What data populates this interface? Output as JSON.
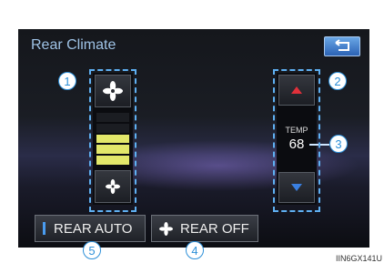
{
  "screen": {
    "title": "Rear Climate"
  },
  "fan": {
    "level_count": 5,
    "active_levels": 3,
    "active_color": "#e3e86a",
    "inactive_color": "#1b1d22"
  },
  "temperature": {
    "label": "TEMP",
    "value": "68"
  },
  "buttons": {
    "rear_auto": "REAR AUTO",
    "rear_off": "REAR OFF"
  },
  "callouts": [
    "1",
    "2",
    "3",
    "4",
    "5"
  ],
  "figure_code": "IIN6GX141U",
  "colors": {
    "accent_blue": "#2c8fd8",
    "up_arrow": "#e0303a",
    "down_arrow": "#3a7fe0"
  }
}
